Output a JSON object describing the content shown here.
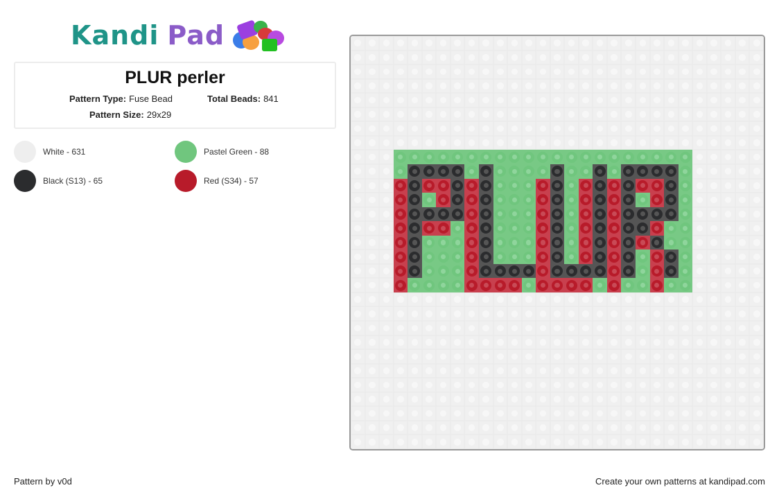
{
  "logo": {
    "word1": "Kandi",
    "word2": "Pad",
    "icon": "bead-pile-icon"
  },
  "pattern": {
    "title": "PLUR perler",
    "type_label": "Pattern Type:",
    "type_value": "Fuse Bead",
    "beads_label": "Total Beads:",
    "beads_value": "841",
    "size_label": "Pattern Size:",
    "size_value": "29x29"
  },
  "palette": [
    {
      "key": "W",
      "label": "White - 631",
      "color": "#f0f0f0",
      "ring": "#f0f0f0",
      "hole": "#f7f7f7"
    },
    {
      "key": "G",
      "label": "Pastel Green - 88",
      "color": "#78c985",
      "ring": "#70c67e",
      "hole": "#8fd59c"
    },
    {
      "key": "K",
      "label": "Black (S13) - 65",
      "color": "#555555",
      "ring": "#2b2c2e",
      "hole": "#555555"
    },
    {
      "key": "R",
      "label": "Red (S34) - 57",
      "color": "#c8404e",
      "ring": "#b81b2a",
      "hole": "#c84a56"
    }
  ],
  "grid": {
    "cols": 29,
    "rows": 29,
    "cells": [
      "WWWWWWWWWWWWWWWWWWWWWWWWWWWWW",
      "WWWWWWWWWWWWWWWWWWWWWWWWWWWWW",
      "WWWWWWWWWWWWWWWWWWWWWWWWWWWWW",
      "WWWWWWWWWWWWWWWWWWWWWWWWWWWWW",
      "WWWWWWWWWWWWWWWWWWWWWWWWWWWWW",
      "WWWWWWWWWWWWWWWWWWWWWWWWWWWWW",
      "WWWWWWWWWWWWWWWWWWWWWWWWWWWWW",
      "WWWWWWWWWWWWWWWWWWWWWWWWWWWWW",
      "WWWGGGGGGGGGGGGGGGGGGGGGWWWWW",
      "WWWGKKKKGKGGGGKGGKGKKKKGWWWWW",
      "WWWRKRRKRKGGGRKGRKRKRRKGWWWWW",
      "WWWRKGRKRKGGGRKGRKRKGRKGWWWWW",
      "WWWRKKKKRKGGGRKGRKRKKKKGWWWWW",
      "WWWRKRRGRKGGGRKGRKRKKRGGWWWWW",
      "WWWRKGGGRKGGGRKGRKRKRKGGWWWWW",
      "WWWRKGGGRKGGGRKGRKRKGRKGWWWWW",
      "WWWRKGGGRKKKKRKKKKRKGRKGWWWWW",
      "WWWRGGGGRRRRGRRRRGRGGRGGWWWWW",
      "WWWWWWWWWWWWWWWWWWWWWWWWWWWWW",
      "WWWWWWWWWWWWWWWWWWWWWWWWWWWWW",
      "WWWWWWWWWWWWWWWWWWWWWWWWWWWWW",
      "WWWWWWWWWWWWWWWWWWWWWWWWWWWWW",
      "WWWWWWWWWWWWWWWWWWWWWWWWWWWWW",
      "WWWWWWWWWWWWWWWWWWWWWWWWWWWWW",
      "WWWWWWWWWWWWWWWWWWWWWWWWWWWWW",
      "WWWWWWWWWWWWWWWWWWWWWWWWWWWWW",
      "WWWWWWWWWWWWWWWWWWWWWWWWWWWWW",
      "WWWWWWWWWWWWWWWWWWWWWWWWWWWWW",
      "WWWWWWWWWWWWWWWWWWWWWWWWWWWWW"
    ]
  },
  "footer": {
    "credit": "Pattern by v0d",
    "cta": "Create your own patterns at kandipad.com"
  }
}
